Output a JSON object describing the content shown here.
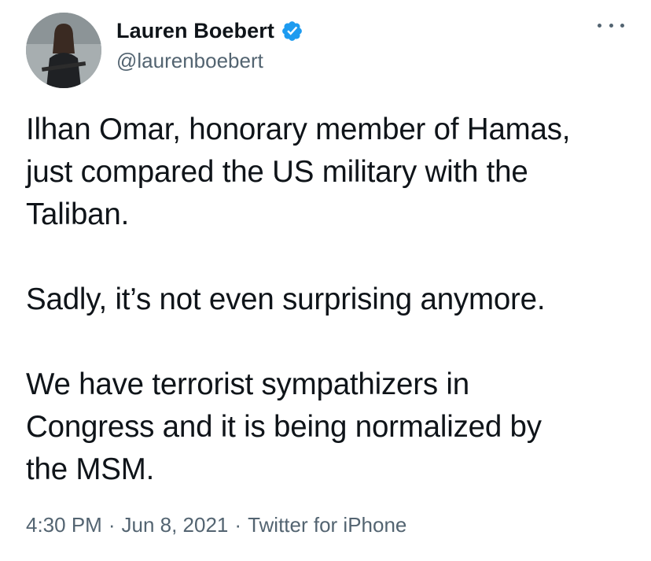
{
  "author": {
    "display_name": "Lauren Boebert",
    "handle": "@laurenboebert",
    "verified_icon": "verified-badge-icon",
    "verified_color": "#1d9bf0",
    "avatar_icon": "profile-photo"
  },
  "menu": {
    "icon": "more-options-icon"
  },
  "tweet": {
    "paragraphs": [
      {
        "lines": [
          "Ilhan Omar, honorary member of Hamas,",
          "just compared the US military with the",
          "Taliban."
        ]
      },
      {
        "lines": [
          "Sadly, it’s not even surprising anymore."
        ]
      },
      {
        "lines": [
          "We have terrorist sympathizers in",
          "Congress and it is being normalized by",
          "the MSM."
        ]
      }
    ]
  },
  "meta": {
    "time": "4:30 PM",
    "separator": "·",
    "date": "Jun 8, 2021",
    "source": "Twitter for iPhone"
  },
  "colors": {
    "text": "#0f1419",
    "secondary": "#536471",
    "background": "#ffffff"
  }
}
